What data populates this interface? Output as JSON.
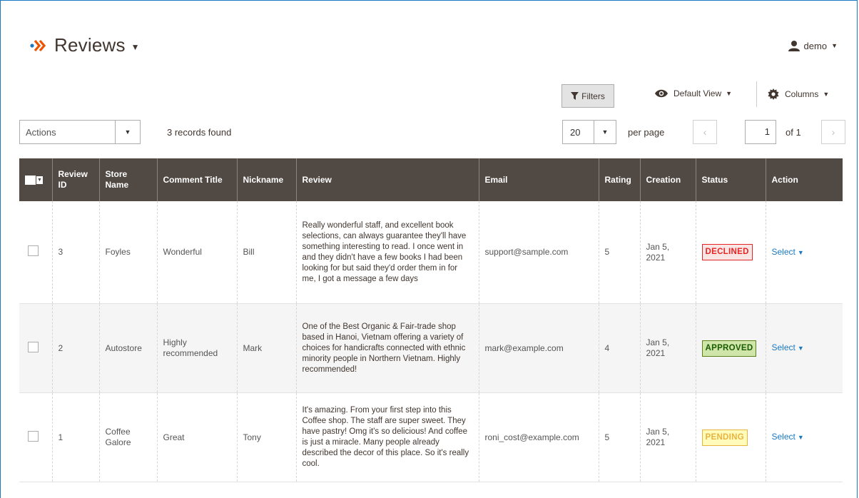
{
  "header": {
    "title": "Reviews",
    "user": "demo"
  },
  "toolbar": {
    "filters_label": "Filters",
    "view_label": "Default View",
    "columns_label": "Columns"
  },
  "actions": {
    "select_value": "Actions",
    "records_found": "3 records found"
  },
  "pagination": {
    "per_page_value": "20",
    "per_page_label": "per page",
    "current_page": "1",
    "of_label": "of 1"
  },
  "columns": [
    "Review ID",
    "Store Name",
    "Comment Title",
    "Nickname",
    "Review",
    "Email",
    "Rating",
    "Creation",
    "Status",
    "Action"
  ],
  "rows": [
    {
      "id": "3",
      "store": "Foyles",
      "title": "Wonderful",
      "nickname": "Bill",
      "review": "Really wonderful staff, and excellent book selections, can always guarantee they'll have something interesting to read. I once went in and they didn't have a few books I had been looking for but said they'd order them in for me, I got a message a few days",
      "email": "support@sample.com",
      "rating": "5",
      "creation": "Jan 5, 2021",
      "status": "DECLINED",
      "action": "Select"
    },
    {
      "id": "2",
      "store": "Autostore",
      "title": "Highly recommended",
      "nickname": "Mark",
      "review": "One of the Best Organic & Fair-trade shop based in Hanoi, Vietnam offering a variety of choices for handicrafts connected with ethnic minority people in Northern Vietnam. Highly recommended!",
      "email": "mark@example.com",
      "rating": "4",
      "creation": "Jan 5, 2021",
      "status": "APPROVED",
      "action": "Select"
    },
    {
      "id": "1",
      "store": "Coffee Galore",
      "title": "Great",
      "nickname": "Tony",
      "review": "It's amazing. From your first step into this Coffee shop. The staff are super sweet. They have pastry! Omg it's so delicious! And coffee is just a miracle. Many people already described the decor of this place. So it's really cool.",
      "email": "roni_cost@example.com",
      "rating": "5",
      "creation": "Jan 5, 2021",
      "status": "PENDING",
      "action": "Select"
    }
  ],
  "colors": {
    "header_bg": "#514943",
    "link": "#1979c3",
    "logo_orange": "#eb5202"
  }
}
